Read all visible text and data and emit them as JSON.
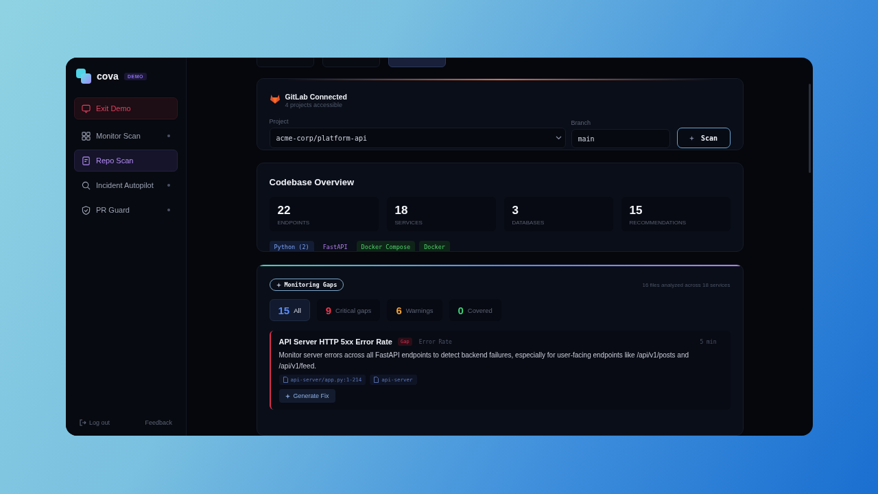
{
  "brand": {
    "name": "cova",
    "badge": "DEMO"
  },
  "sidebar": {
    "items": [
      {
        "kind": "exit",
        "label": "Exit Demo",
        "selected": false,
        "dot": false
      },
      {
        "kind": "nav",
        "label": "Monitor Scan",
        "selected": false,
        "dot": true
      },
      {
        "kind": "nav",
        "label": "Repo Scan",
        "selected": true,
        "dot": false
      },
      {
        "kind": "nav",
        "label": "Incident Autopilot",
        "selected": false,
        "dot": true
      },
      {
        "kind": "nav",
        "label": "PR Guard",
        "selected": false,
        "dot": true
      }
    ],
    "footer": {
      "logout": "Log out",
      "feedback": "Feedback"
    }
  },
  "source_tabs": [
    {
      "selected": false
    },
    {
      "selected": false
    },
    {
      "selected": true
    }
  ],
  "connection": {
    "title": "GitLab Connected",
    "subtitle": "4 projects accessible",
    "project_label": "Project",
    "project": "acme-corp/platform-api",
    "branch_label": "Branch",
    "branch": "main",
    "scan_button": "Scan"
  },
  "overview": {
    "title": "Codebase Overview",
    "stats": [
      {
        "value": "22",
        "label": "ENDPOINTS"
      },
      {
        "value": "18",
        "label": "SERVICES"
      },
      {
        "value": "3",
        "label": "DATABASES"
      },
      {
        "value": "15",
        "label": "RECOMMENDATIONS"
      }
    ],
    "tags": [
      {
        "label": "Python (2)",
        "kind": "language"
      },
      {
        "label": "FastAPI",
        "kind": "framework"
      },
      {
        "label": "Docker Compose",
        "kind": "infra"
      },
      {
        "label": "Docker",
        "kind": "infra"
      }
    ]
  },
  "gaps": {
    "badge": "Monitoring Gaps",
    "summary": "16 files analyzed across 18 services",
    "filters": [
      {
        "count": "15",
        "label": "All",
        "color": "#5b8cf5",
        "selected": true
      },
      {
        "count": "9",
        "label": "Critical gaps",
        "color": "#f0364f",
        "selected": false
      },
      {
        "count": "6",
        "label": "Warnings",
        "color": "#f0a43a",
        "selected": false
      },
      {
        "count": "0",
        "label": "Covered",
        "color": "#3ed07a",
        "selected": false
      }
    ],
    "items": [
      {
        "title": "API Server HTTP 5xx Error Rate",
        "severity": "Gap",
        "category": "Error Rate",
        "time": "5 min",
        "description": "Monitor server errors across all FastAPI endpoints to detect backend failures, especially for user-facing endpoints like /api/v1/posts and /api/v1/feed.",
        "refs": [
          "api-server/app.py:1-214",
          "api-server"
        ],
        "action": "Generate Fix"
      }
    ]
  }
}
